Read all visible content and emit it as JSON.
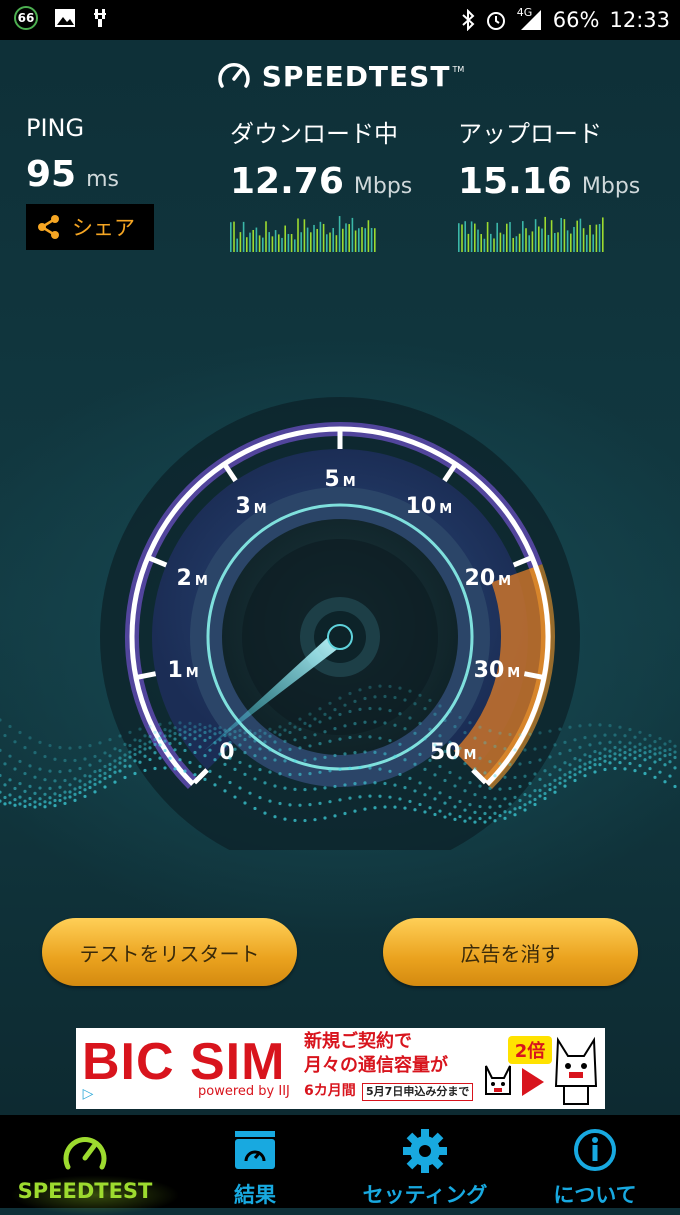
{
  "status_bar": {
    "notification_badge": "66",
    "network_type": "4G",
    "battery_percent": "66%",
    "time": "12:33",
    "icons": [
      "image-icon",
      "usb-debug-icon",
      "bluetooth-icon",
      "alarm-icon",
      "signal-icon",
      "battery-icon"
    ]
  },
  "header": {
    "logo_text": "SPEEDTEST",
    "logo_tm": "TM"
  },
  "metrics": {
    "ping": {
      "label": "PING",
      "value": "95",
      "unit": "ms"
    },
    "download": {
      "label": "ダウンロード中",
      "value": "12.76",
      "unit": "Mbps"
    },
    "upload": {
      "label": "アップロード",
      "value": "15.16",
      "unit": "Mbps"
    }
  },
  "share_button": {
    "label": "シェア"
  },
  "gauge": {
    "tick_labels": [
      "0",
      "1",
      "2",
      "3",
      "5",
      "10",
      "20",
      "30",
      "50"
    ],
    "unit_suffix": "M",
    "needle_value_mbps": 0.15,
    "colors": {
      "arc_low": "#8a5cf5",
      "arc_high": "#f39a2c",
      "needle": "#9ff3ff"
    }
  },
  "buttons": {
    "restart": "テストをリスタート",
    "remove_ads": "広告を消す"
  },
  "ad": {
    "brand": "BIC SIM",
    "powered": "powered by IIJ",
    "line1": "新規ご契約で",
    "line2": "月々の通信容量が",
    "line3": "6カ月間",
    "date": "5月7日申込み分まで",
    "badge": "2倍"
  },
  "nav": {
    "items": [
      {
        "label": "SPEEDTEST",
        "icon": "speedometer-icon",
        "active": true
      },
      {
        "label": "結果",
        "icon": "results-folder-icon",
        "active": false
      },
      {
        "label": "セッティング",
        "icon": "gear-icon",
        "active": false
      },
      {
        "label": "について",
        "icon": "info-icon",
        "active": false
      }
    ]
  },
  "colors": {
    "accent_active": "#9ddb2f",
    "accent_nav": "#18a9e0",
    "share_text": "#f6a623"
  }
}
